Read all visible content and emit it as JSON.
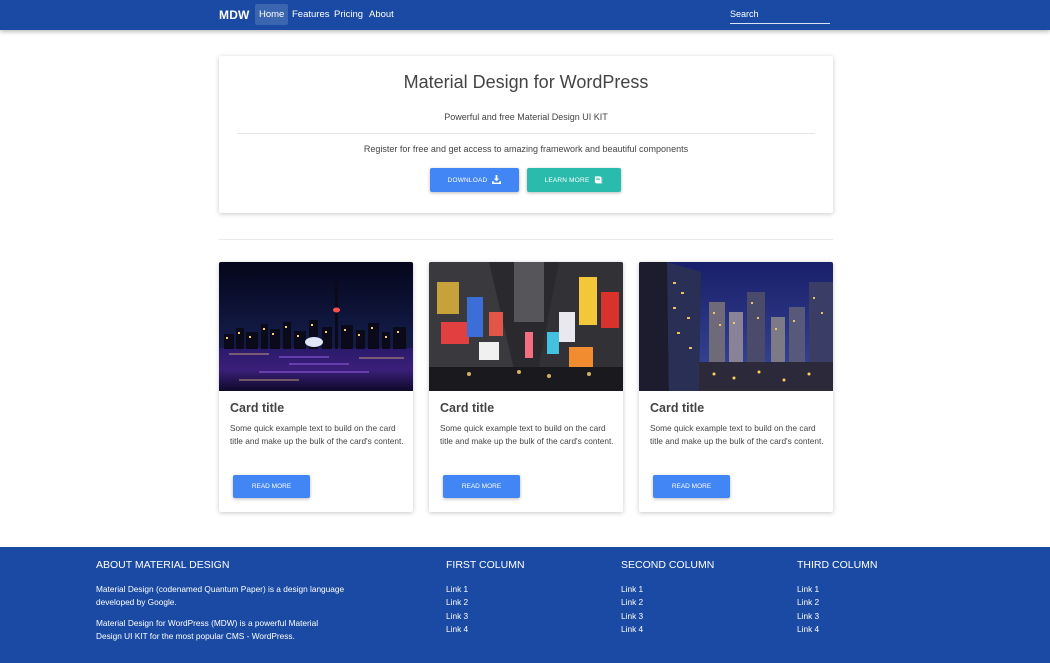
{
  "navbar": {
    "brand": "MDW",
    "links": [
      "Home",
      "Features",
      "Pricing",
      "About"
    ],
    "search_placeholder": "Search"
  },
  "jumbotron": {
    "title": "Material Design for WordPress",
    "lead": "Powerful and free Material Design UI KIT",
    "text": "Register for free and get access to amazing framework and beautiful components",
    "download_label": "Download",
    "learn_label": "Learn more"
  },
  "cards": [
    {
      "title": "Card title",
      "text": "Some quick example text to build on the card title and make up the bulk of the card's content.",
      "button": "Read more",
      "image": "city-skyline-night-photo"
    },
    {
      "title": "Card title",
      "text": "Some quick example text to build on the card title and make up the bulk of the card's content.",
      "button": "Read more",
      "image": "times-square-billboards-photo"
    },
    {
      "title": "Card title",
      "text": "Some quick example text to build on the card title and make up the bulk of the card's content.",
      "button": "Read more",
      "image": "skyscrapers-dusk-photo"
    }
  ],
  "footer": {
    "about_heading": "About Material Design",
    "about_p1": "Material Design (codenamed Quantum Paper) is a design language developed by Google.",
    "about_p2": "Material Design for WordPress (MDW) is a powerful Material Design UI KIT for the most popular CMS - WordPress.",
    "columns": [
      {
        "heading": "First column",
        "links": [
          "Link 1",
          "Link 2",
          "Link 3",
          "Link 4"
        ]
      },
      {
        "heading": "Second column",
        "links": [
          "Link 1",
          "Link 2",
          "Link 3",
          "Link 4"
        ]
      },
      {
        "heading": "Third column",
        "links": [
          "Link 1",
          "Link 2",
          "Link 3",
          "Link 4"
        ]
      }
    ]
  },
  "colors": {
    "navbar": "#1a4aa3",
    "primary": "#4285f4",
    "secondary": "#2bbbad"
  },
  "icons": {
    "download": "download-icon",
    "learn_more": "book-icon"
  }
}
